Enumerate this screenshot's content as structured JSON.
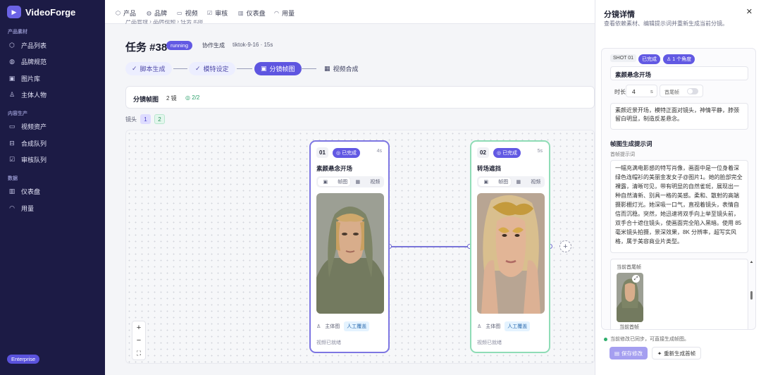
{
  "app": {
    "name": "VideoForge",
    "plan": "Enterprise"
  },
  "sidebar": {
    "sections": [
      {
        "title": "产品素材",
        "items": [
          {
            "label": "产品列表",
            "icon": "cube-icon"
          },
          {
            "label": "品牌规范",
            "icon": "palette-icon"
          },
          {
            "label": "图片库",
            "icon": "image-icon"
          },
          {
            "label": "主体人物",
            "icon": "person-icon"
          }
        ]
      },
      {
        "title": "内容生产",
        "items": [
          {
            "label": "视频资产",
            "icon": "video-icon"
          },
          {
            "label": "合成队列",
            "icon": "queue-icon"
          },
          {
            "label": "审核队列",
            "icon": "check-icon"
          }
        ]
      },
      {
        "title": "数据",
        "items": [
          {
            "label": "仪表盘",
            "icon": "chart-icon"
          },
          {
            "label": "用量",
            "icon": "gauge-icon"
          }
        ]
      }
    ]
  },
  "topnav": [
    {
      "label": "产品",
      "icon": "cube-icon"
    },
    {
      "label": "品牌",
      "icon": "palette-icon"
    },
    {
      "label": "视频",
      "icon": "video-icon"
    },
    {
      "label": "审核",
      "icon": "check-icon"
    },
    {
      "label": "仪表盘",
      "icon": "chart-icon"
    },
    {
      "label": "用量",
      "icon": "gauge-icon"
    }
  ],
  "breadcrumb": "产品管理  ›  品牌视频  ›  任务 #38",
  "task": {
    "title": "任务 #38",
    "status": "running",
    "collab": "协作生成",
    "meta": "tiktok-9-16  ·  15s"
  },
  "steps": [
    {
      "label": "脚本生成",
      "state": "done"
    },
    {
      "label": "模特设定",
      "state": "done"
    },
    {
      "label": "分镜帧图",
      "state": "active"
    },
    {
      "label": "视频合成",
      "state": "todo"
    }
  ],
  "storyboard": {
    "title": "分镜帧图",
    "count": "2 镜",
    "done": "2/2",
    "lens_label": "镜头",
    "lens": [
      "1",
      "2"
    ]
  },
  "cards": [
    {
      "num": "01",
      "status": "已完成",
      "duration": "4s",
      "title": "素颜悬念开场",
      "tab_frame": "帧图",
      "tab_video": "视频",
      "subject": "主体图",
      "tag": "人工覆盖",
      "video_status": "视频已就绪"
    },
    {
      "num": "02",
      "status": "已完成",
      "duration": "5s",
      "title": "转场遮挡",
      "tab_frame": "帧图",
      "tab_video": "视频",
      "subject": "主体图",
      "tag": "人工覆盖",
      "video_status": "视频已就绪"
    }
  ],
  "zoom": {
    "in": "+",
    "out": "−",
    "fit": "⛶"
  },
  "detail": {
    "title": "分镜详情",
    "subtitle": "查看依赖素材、编辑提示词并重新生成当前分镜。",
    "shot": "SHOT 01",
    "status": "已完成",
    "angle": "1 个角度",
    "name": "素颜悬念开场",
    "length_label": "时长",
    "length_value": "4",
    "length_unit": "s",
    "first_last_label": "首尾帧",
    "description": "素颜近景开场，模特正面对镜头，神情平静，脖颈留白明显，制造反差悬念。",
    "prompt_title": "帧图生成提示词",
    "prompt_sub": "首帧提示词",
    "prompt": "一幅充满电影感的特写肖像，画面中是一位身着深绿色连帽衫的美丽金发女子@图片1。她的脸部完全裸露，清晰可见，带有明显的自然雀斑，展现出一种自然清新、别具一格的美感。柔和、散射的高端摄影棚灯光。她深吸一口气，直视着镜头，表情自信而沉稳。突然，她迅速将双手向上举至镜头前，双手合十遮住镜头，使画面完全陷入黑暗。使用 85 毫米镜头拍摄，景深效果，8K 分辨率，超写实风格，属于美容商业片类型。",
    "current_label": "当前首尾帧",
    "thumb_label": "当前首帧",
    "sync_text": "当前修改已同步，可直接生成帧图。",
    "save": "保存修改",
    "regen": "重新生成首帧"
  },
  "colors": {
    "sidebar": "#1c1b45",
    "accent": "#6259e3",
    "success": "#2fae6c"
  }
}
